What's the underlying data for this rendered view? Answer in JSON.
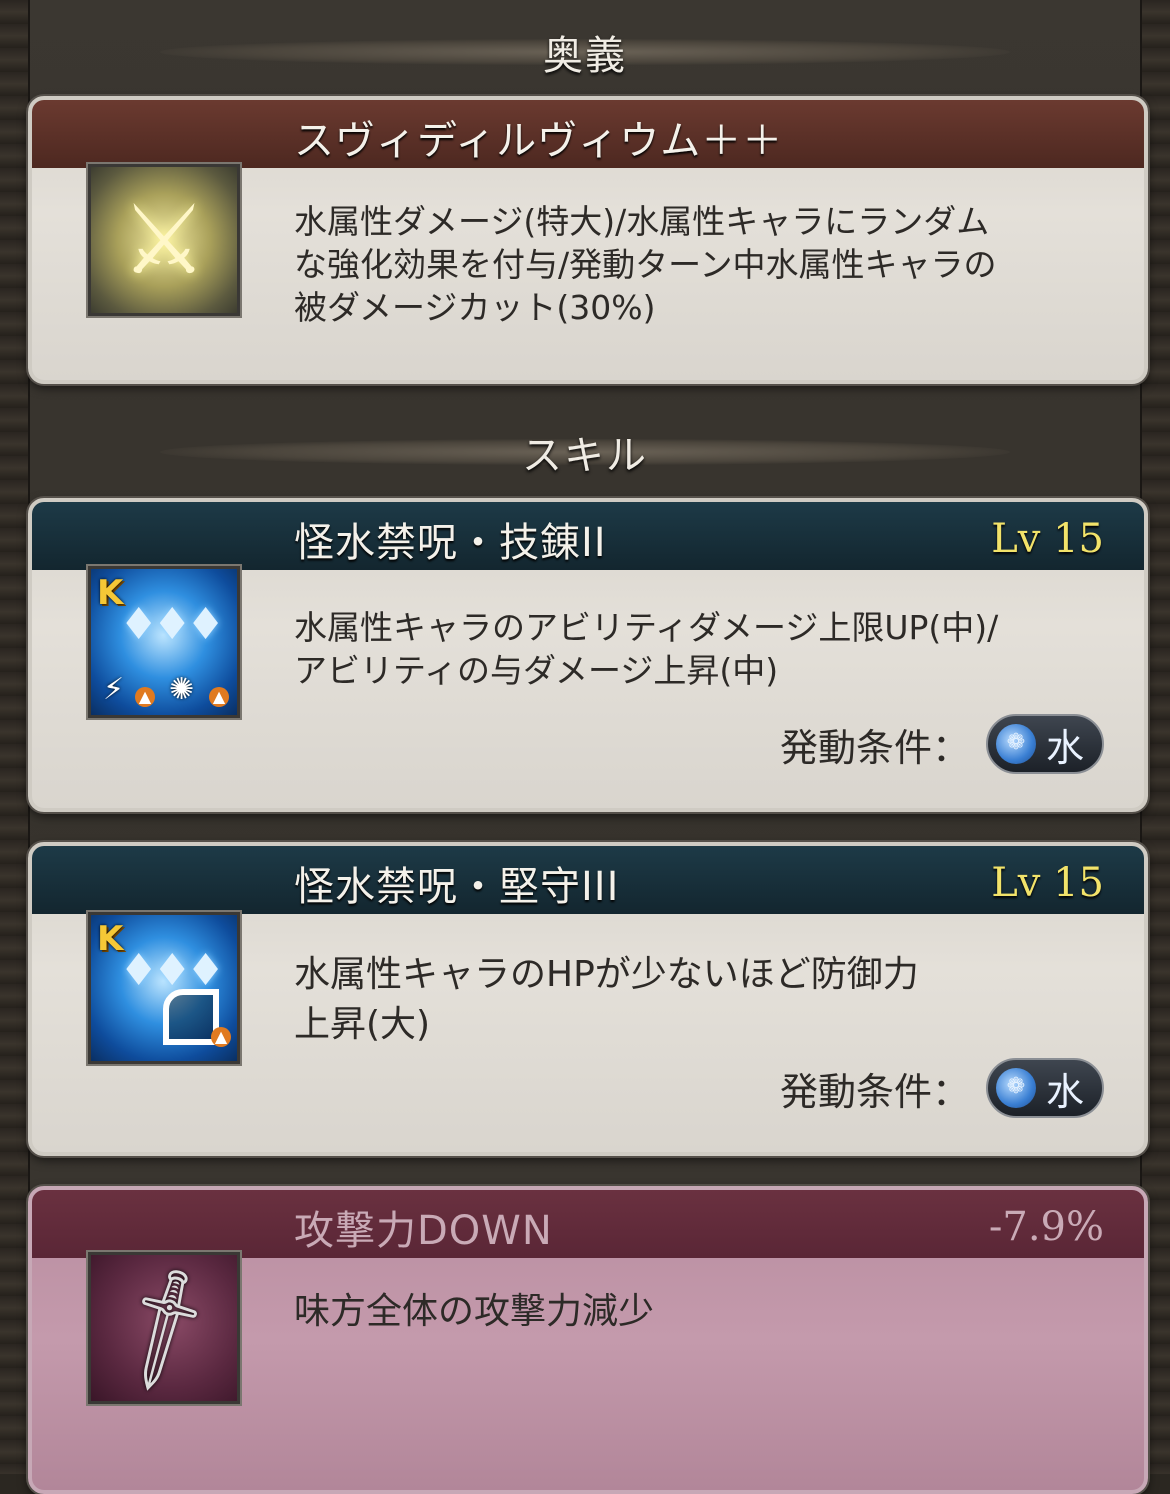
{
  "sections": {
    "ougi_title": "奥義",
    "skill_title": "スキル"
  },
  "ougi": {
    "name": "スヴィディルヴィウム＋＋",
    "desc_line1": "水属性ダメージ(特大)/水属性キャラにランダム",
    "desc_line2": "な強化効果を付与/発動ターン中水属性キャラの",
    "desc_line3": "被ダメージカット(30%)",
    "icon": "crossed-swords-icon"
  },
  "skills": [
    {
      "name": "怪水禁呪・技錬II",
      "level": "Lv 15",
      "desc_line1": "水属性キャラのアビリティダメージ上限UP(中)/",
      "desc_line2": "アビリティの与ダメージ上昇(中)",
      "cond_label": "発動条件：",
      "cond_value": "水",
      "badge": "K"
    },
    {
      "name": "怪水禁呪・堅守III",
      "level": "Lv 15",
      "desc_line1": "水属性キャラのHPが少ないほど防御力",
      "desc_line2": "上昇(大)",
      "cond_label": "発動条件：",
      "cond_value": "水",
      "badge": "K"
    }
  ],
  "debuff": {
    "name": "攻撃力DOWN",
    "value": "-7.9%",
    "desc": "味方全体の攻撃力減少",
    "icon": "dagger-icon"
  },
  "colors": {
    "level_text": "#f2e36a",
    "ougi_header": "#5a3027",
    "skill_header": "#17303b",
    "debuff_header": "#62293a"
  }
}
